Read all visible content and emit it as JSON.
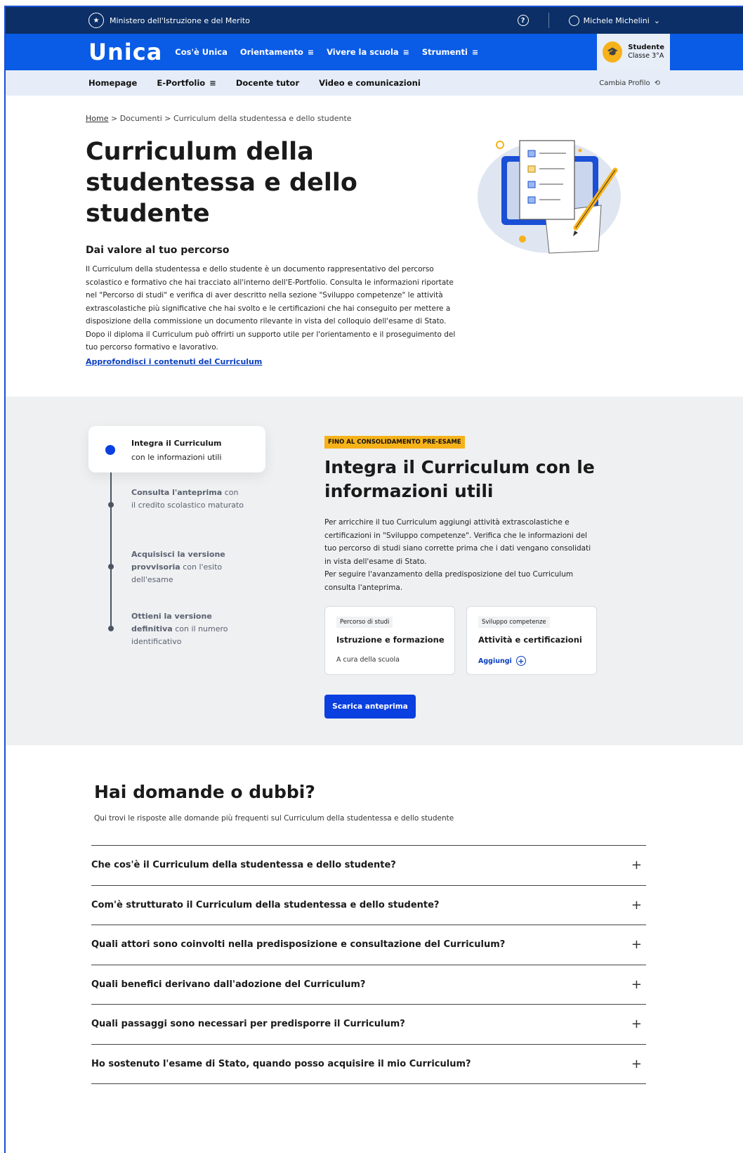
{
  "topbar": {
    "ministry": "Ministero dell'Istruzione e del Merito",
    "help": "?",
    "user_name": "Michele Michelini"
  },
  "mainnav": {
    "logo": "Unica",
    "items": [
      "Cos'è Unica",
      "Orientamento",
      "Vivere la scuola",
      "Strumenti"
    ],
    "profile_role": "Studente",
    "profile_class": "Classe 3°A"
  },
  "subnav": {
    "items": [
      "Homepage",
      "E-Portfolio",
      "Docente tutor",
      "Video e comunicazioni"
    ],
    "change_profile": "Cambia Profilo"
  },
  "breadcrumb": {
    "home": "Home",
    "sep": ">",
    "docs": "Documenti",
    "current": "Curriculum della studentessa e dello studente"
  },
  "hero": {
    "title": "Curriculum della studentessa e dello studente",
    "subtitle": "Dai valore al tuo percorso",
    "text": "Il Curriculum della studentessa e dello studente è un documento rappresentativo del percorso scolastico e formativo che hai tracciato all'interno dell'E-Portfolio. Consulta le informazioni riportate nel \"Percorso di studi\" e verifica di aver descritto nella sezione \"Sviluppo competenze\" le attività extrascolastiche più significative che hai svolto e le certificazioni che hai conseguito per mettere a disposizione della commissione un documento rilevante in vista del colloquio dell'esame di Stato. Dopo il diploma il Curriculum può offrirti un supporto utile per l'orientamento e il proseguimento del tuo percorso formativo e lavorativo.",
    "link": "Approfondisci i contenuti del Curriculum"
  },
  "steps": {
    "active": {
      "title": "Integra il Curriculum",
      "rest": "con le informazioni utili"
    },
    "s2": {
      "title": "Consulta l'anteprima",
      "rest": "con il credito scolastico maturato"
    },
    "s3": {
      "title": "Acquisisci la versione provvisoria",
      "rest": "con l'esito dell'esame"
    },
    "s4": {
      "title": "Ottieni la versione definitiva",
      "rest": "con il numero identificativo"
    },
    "badge": "FINO AL CONSOLIDAMENTO PRE-ESAME",
    "heading": "Integra il Curriculum con le informazioni utili",
    "text1": "Per arricchire il tuo Curriculum aggiungi attività extrascolastiche e certificazioni in \"Sviluppo competenze\". Verifica che le informazioni del tuo percorso di studi siano corrette prima che i dati vengano consolidati in vista dell'esame di Stato.",
    "text2": "Per seguire l'avanzamento della predisposizione del tuo Curriculum consulta l'anteprima.",
    "card1": {
      "tag": "Percorso di studi",
      "title": "Istruzione e formazione",
      "foot": "A cura della scuola"
    },
    "card2": {
      "tag": "Sviluppo competenze",
      "title": "Attività e certificazioni",
      "foot": "Aggiungi"
    },
    "button": "Scarica anteprima"
  },
  "faq": {
    "title": "Hai domande o dubbi?",
    "subtitle": "Qui trovi le risposte alle domande più frequenti sul Curriculum della studentessa e dello studente",
    "items": [
      "Che cos'è il Curriculum della studentessa e dello studente?",
      "Com'è strutturato il Curriculum della studentessa e dello studente?",
      "Quali attori sono coinvolti nella predisposizione e consultazione del Curriculum?",
      "Quali benefici derivano dall'adozione del Curriculum?",
      "Quali passaggi sono necessari per predisporre il Curriculum?",
      "Ho sostenuto l'esame di Stato, quando posso acquisire il mio Curriculum?"
    ]
  }
}
